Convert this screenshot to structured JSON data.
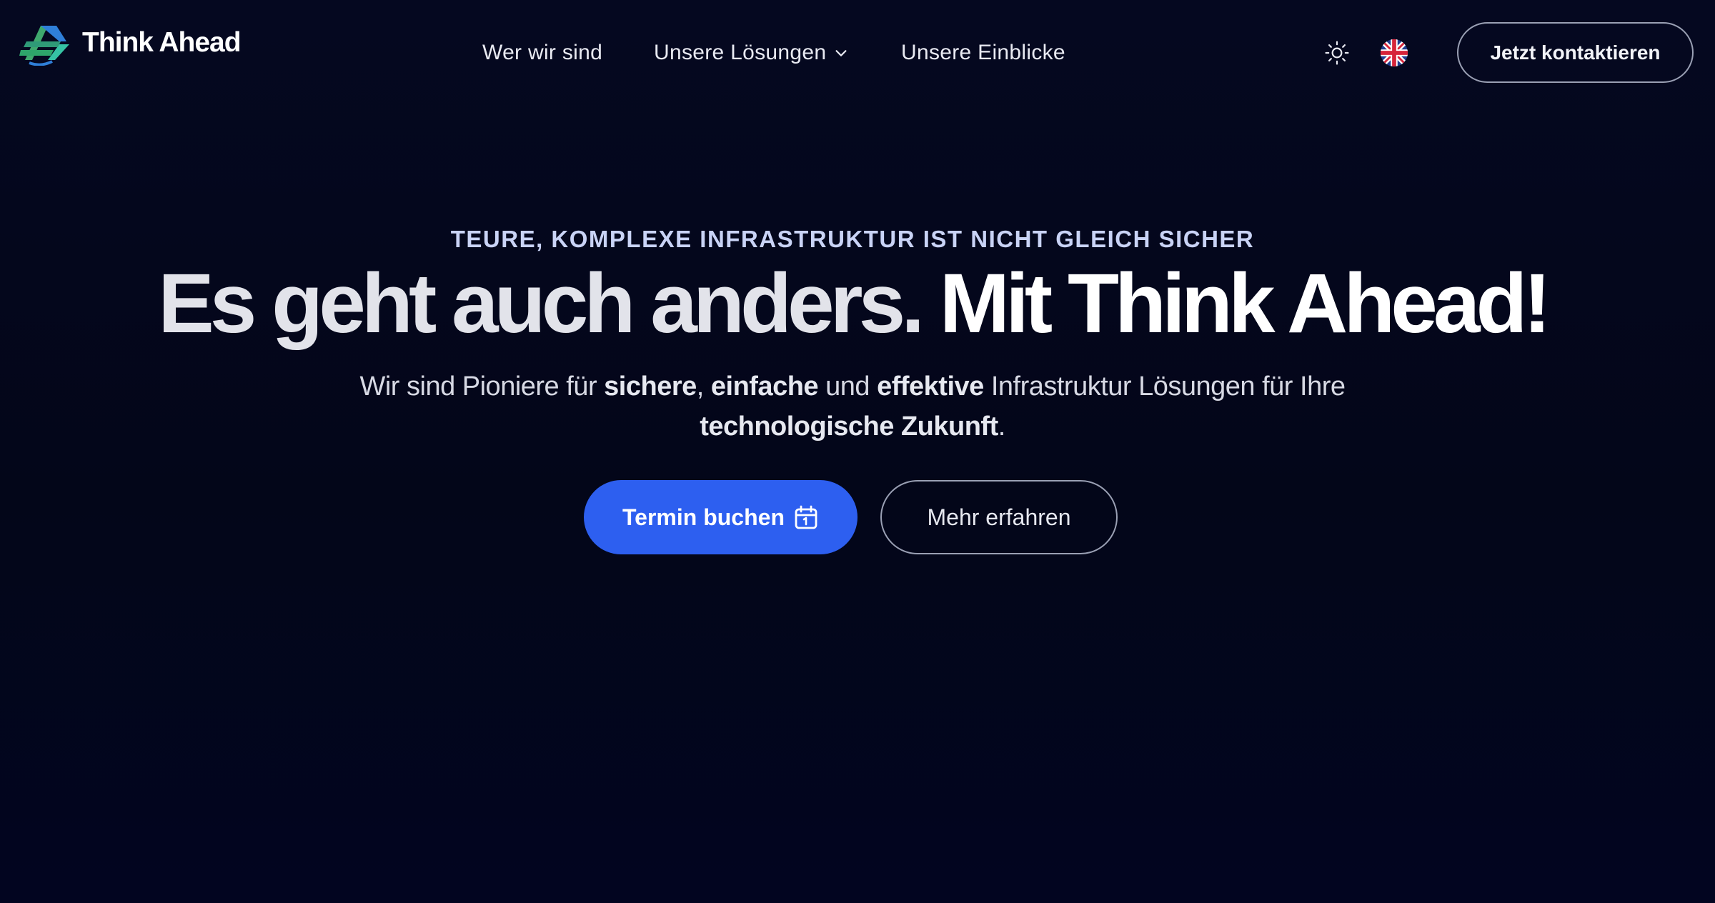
{
  "brand": {
    "name": "Think Ahead"
  },
  "nav": {
    "items": [
      {
        "label": "Wer wir sind"
      },
      {
        "label": "Unsere Lösungen",
        "has_dropdown": true
      },
      {
        "label": "Unsere Einblicke"
      }
    ]
  },
  "header_actions": {
    "theme_icon": "sun-icon",
    "language_icon": "uk-flag-icon",
    "contact_label": "Jetzt kontaktieren"
  },
  "hero": {
    "eyebrow": "TEURE, KOMPLEXE INFRASTRUKTUR IST NICHT GLEICH SICHER",
    "headline_part1": "Es geht auch anders.",
    "headline_part2": "Mit Think Ahead!",
    "sub": {
      "t1": "Wir sind Pioniere für ",
      "b1": "sichere",
      "t2": ", ",
      "b2": "einfache",
      "t3": " und ",
      "b3": "effektive",
      "t4": " Infrastruktur Lösungen für Ihre ",
      "b4": "technologische Zukunft",
      "t5": "."
    },
    "primary_button": "Termin buchen",
    "secondary_button": "Mehr erfahren"
  },
  "colors": {
    "background": "#04061d",
    "primary": "#2d5ff0",
    "logo_green": "#3fa86e",
    "logo_blue": "#2f7fd8"
  }
}
